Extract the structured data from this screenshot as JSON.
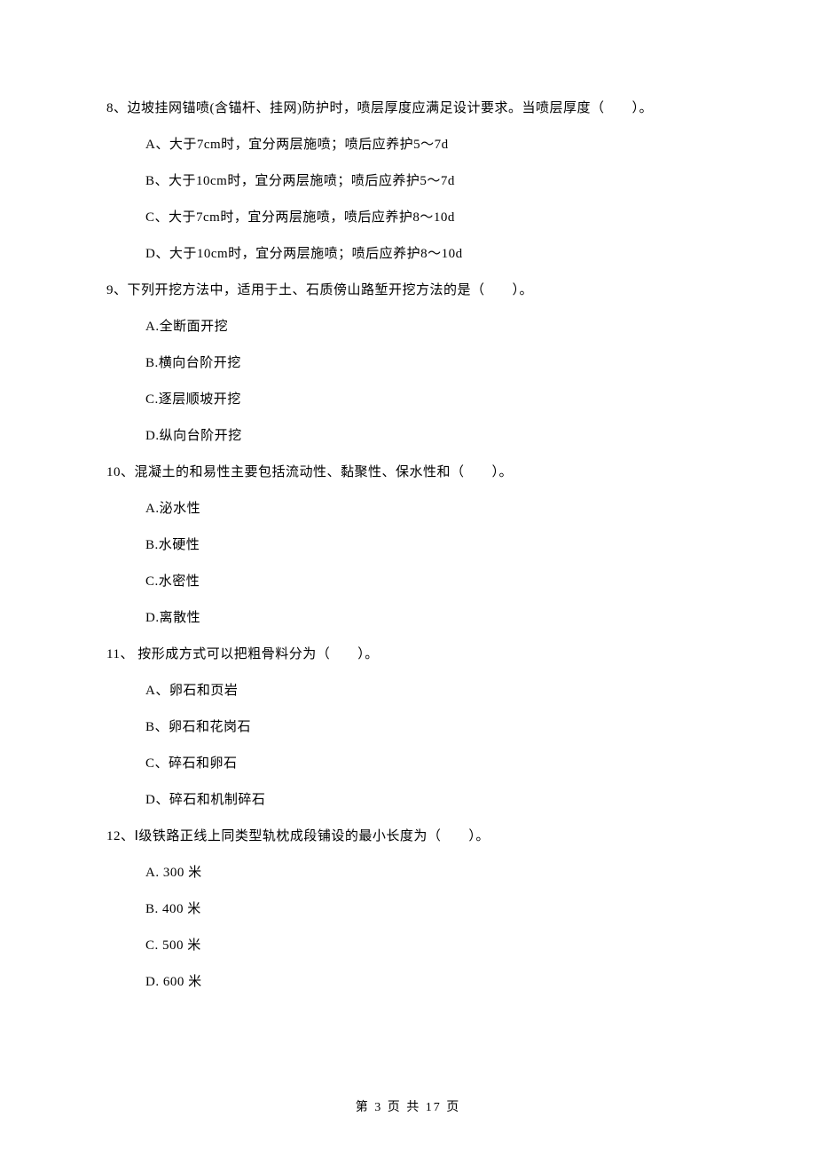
{
  "questions": [
    {
      "stem": "8、边坡挂网锚喷(含锚杆、挂网)防护时，喷层厚度应满足设计要求。当喷层厚度（　　）。",
      "options": [
        "A、大于7cm时，宜分两层施喷；喷后应养护5～7d",
        "B、大于10cm时，宜分两层施喷；喷后应养护5～7d",
        "C、大于7cm时，宜分两层施喷，喷后应养护8～10d",
        "D、大于10cm时，宜分两层施喷；喷后应养护8～10d"
      ]
    },
    {
      "stem": "9、下列开挖方法中，适用于土、石质傍山路堑开挖方法的是（　　）。",
      "options": [
        "A.全断面开挖",
        "B.横向台阶开挖",
        "C.逐层顺坡开挖",
        "D.纵向台阶开挖"
      ]
    },
    {
      "stem": "10、混凝土的和易性主要包括流动性、黏聚性、保水性和（　　）。",
      "options": [
        "A.泌水性",
        "B.水硬性",
        "C.水密性",
        "D.离散性"
      ]
    },
    {
      "stem": "11、 按形成方式可以把粗骨料分为（　　）。",
      "options": [
        "A、卵石和页岩",
        "B、卵石和花岗石",
        "C、碎石和卵石",
        "D、碎石和机制碎石"
      ]
    },
    {
      "stem": "12、Ⅰ级铁路正线上同类型轨枕成段铺设的最小长度为（　　）。",
      "options": [
        "A. 300 米",
        "B. 400 米",
        "C. 500 米",
        "D. 600 米"
      ]
    }
  ],
  "footer": "第 3 页 共 17 页"
}
